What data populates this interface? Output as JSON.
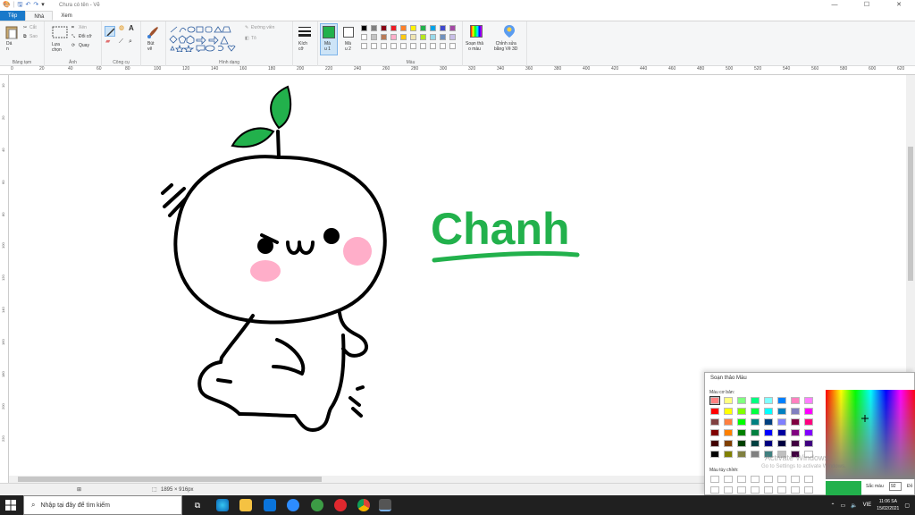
{
  "window": {
    "title": "Chưa có tên - Vẽ",
    "controls": [
      "—",
      "☐",
      "✕"
    ]
  },
  "tabs": [
    {
      "label": "Tệp",
      "kind": "file"
    },
    {
      "label": "Nhà",
      "kind": "active"
    },
    {
      "label": "Xem",
      "kind": ""
    }
  ],
  "ribbon": {
    "clipboard": {
      "paste": "Dá\nn",
      "cut": "Cắt",
      "copy": "Sao",
      "label": "Bảng tạm"
    },
    "image": {
      "select": "Lựa\nchọn",
      "crop": "Xén",
      "resize": "Đổi cỡ",
      "rotate": "Quay",
      "label": "Ảnh"
    },
    "tools": {
      "label": "Công cụ"
    },
    "brushes": {
      "text": "Bút\nvẽ",
      "label": ""
    },
    "shapes": {
      "outline": "Đường viền",
      "fill": "Tô",
      "label": "Hình dạng"
    },
    "size": {
      "text": "Kích\ncỡ",
      "label": ""
    },
    "color1": {
      "text": "Mà\nu 1",
      "value": "#22b14c"
    },
    "color2": {
      "text": "Mà\nu 2",
      "value": "#ffffff"
    },
    "colors": {
      "label": "Màu"
    },
    "edit_colors": {
      "text": "Soạn thả\no màu"
    },
    "paint3d": {
      "text": "Chỉnh sửa\nbằng Vẽ 3D"
    }
  },
  "palette": [
    "#000000",
    "#7f7f7f",
    "#880015",
    "#ed1c24",
    "#ff7f27",
    "#fff200",
    "#22b14c",
    "#00a2e8",
    "#3f48cc",
    "#a349a4",
    "#ffffff",
    "#c3c3c3",
    "#b97a57",
    "#ffaec9",
    "#ffc90e",
    "#efe4b0",
    "#b5e61d",
    "#99d9ea",
    "#7092be",
    "#c8bfe7",
    "#ffffff",
    "#ffffff",
    "#ffffff",
    "#ffffff",
    "#ffffff",
    "#ffffff",
    "#ffffff",
    "#ffffff",
    "#ffffff",
    "#ffffff"
  ],
  "ruler_ticks": [
    "0",
    "20",
    "40",
    "60",
    "80",
    "100",
    "120",
    "140",
    "160",
    "180",
    "200",
    "220",
    "240",
    "260",
    "280",
    "300",
    "320",
    "340",
    "360",
    "380",
    "400",
    "420",
    "440",
    "460",
    "480",
    "500",
    "520",
    "540",
    "560",
    "580",
    "600",
    "620"
  ],
  "vruler_ticks": [
    "10",
    "20",
    "40",
    "60",
    "80",
    "100",
    "120",
    "140",
    "160",
    "180",
    "200",
    "220"
  ],
  "canvas": {
    "text": "Chanh",
    "text_color": "#22b14c",
    "leaf_color": "#22b14c",
    "blush_color": "#ffaec9"
  },
  "status": {
    "dimensions": "1895 × 916px"
  },
  "taskbar": {
    "search_placeholder": "Nhập tại đây để tìm kiếm",
    "lang": "VIE",
    "time": "11:06 SA",
    "date": "15/02/2021"
  },
  "color_editor": {
    "title": "Soạn thảo Màu",
    "basic_label": "Màu cơ bản:",
    "custom_label": "Màu tùy chỉnh:",
    "preview_color": "#22b14c",
    "field_label": "Sắc màu",
    "field_value": "92",
    "field_label2": "Đỏ",
    "basic_colors": [
      "#ff8080",
      "#ffff80",
      "#80ff80",
      "#00ff80",
      "#80ffff",
      "#0080ff",
      "#ff80c0",
      "#ff80ff",
      "#ff0000",
      "#ffff00",
      "#80ff00",
      "#00ff40",
      "#00ffff",
      "#0080c0",
      "#8080c0",
      "#ff00ff",
      "#804040",
      "#ff8040",
      "#00ff00",
      "#008080",
      "#004080",
      "#8080ff",
      "#800040",
      "#ff0080",
      "#800000",
      "#ff8000",
      "#008000",
      "#008040",
      "#0000ff",
      "#0000a0",
      "#800080",
      "#8000ff",
      "#400000",
      "#804000",
      "#004000",
      "#004040",
      "#000080",
      "#000040",
      "#400040",
      "#400080",
      "#000000",
      "#808000",
      "#808040",
      "#808080",
      "#408080",
      "#c0c0c0",
      "#400040",
      "#ffffff"
    ]
  },
  "watermark": {
    "line1": "Activate Windows",
    "line2": "Go to Settings to activate Windows."
  }
}
